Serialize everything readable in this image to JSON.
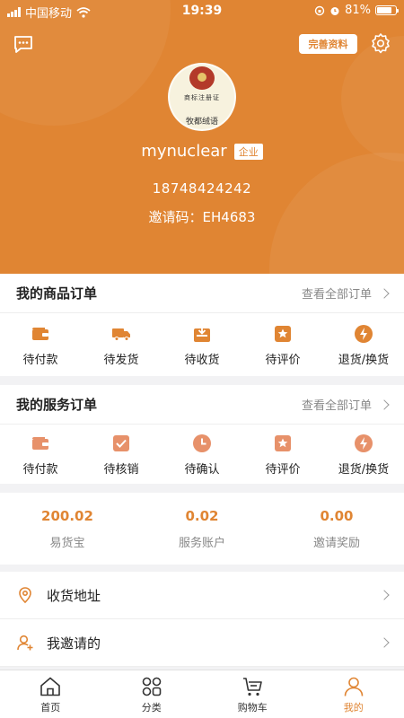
{
  "status_bar": {
    "carrier": "中国移动",
    "time": "19:39",
    "battery": "81%",
    "battery_level": 0.81
  },
  "header": {
    "perfect_button": "完善资料",
    "avatar_text_top": "商标注册证",
    "avatar_text_bottom": "牧都绒语",
    "username": "mynuclear",
    "badge": "企业",
    "phone": "18748424242",
    "invite_code": "邀请码：EH4683"
  },
  "goods_orders": {
    "title": "我的商品订单",
    "view_all": "查看全部订单",
    "items": [
      {
        "label": "待付款",
        "icon": "wallet-icon"
      },
      {
        "label": "待发货",
        "icon": "truck-icon"
      },
      {
        "label": "待收货",
        "icon": "inbox-icon"
      },
      {
        "label": "待评价",
        "icon": "star-icon"
      },
      {
        "label": "退货/换货",
        "icon": "bolt-icon"
      }
    ]
  },
  "service_orders": {
    "title": "我的服务订单",
    "view_all": "查看全部订单",
    "items": [
      {
        "label": "待付款",
        "icon": "wallet-icon"
      },
      {
        "label": "待核销",
        "icon": "check-icon"
      },
      {
        "label": "待确认",
        "icon": "clock-icon"
      },
      {
        "label": "待评价",
        "icon": "star-icon"
      },
      {
        "label": "退货/换货",
        "icon": "bolt-icon"
      }
    ]
  },
  "stats": [
    {
      "value": "200.02",
      "label": "易货宝"
    },
    {
      "value": "0.02",
      "label": "服务账户"
    },
    {
      "value": "0.00",
      "label": "邀请奖励"
    }
  ],
  "menu": [
    {
      "label": "收货地址",
      "icon": "location-icon"
    },
    {
      "label": "我邀请的",
      "icon": "user-add-icon"
    }
  ],
  "tabbar": [
    {
      "label": "首页",
      "icon": "home-icon"
    },
    {
      "label": "分类",
      "icon": "category-icon"
    },
    {
      "label": "购物车",
      "icon": "cart-icon"
    },
    {
      "label": "我的",
      "icon": "user-icon",
      "active": true
    }
  ],
  "colors": {
    "accent": "#e08533",
    "icon_light": "#e7916a"
  }
}
